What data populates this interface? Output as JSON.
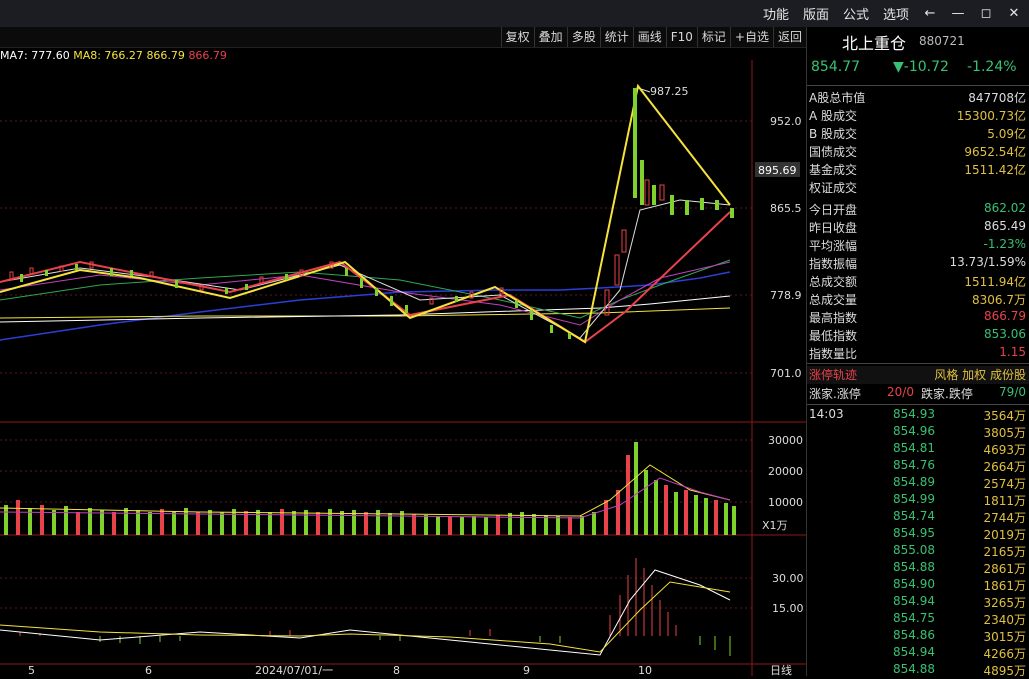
{
  "menu": {
    "items": [
      "功能",
      "版面",
      "公式",
      "选项"
    ],
    "back_icon": "←",
    "min_icon": "—",
    "restore_icon": "◻",
    "close_icon": "✕"
  },
  "toolbar": {
    "buttons": [
      "复权",
      "叠加",
      "多股",
      "统计",
      "画线",
      "F10",
      "标记",
      "+自选",
      "返回"
    ]
  },
  "ma_legend": {
    "ma7": "MA7: 777.60",
    "ma8": "MA8: 766.27",
    "v1": "866.79",
    "v2": "866.79"
  },
  "price_axis": [
    "952.0",
    "865.5",
    "778.9",
    "701.0"
  ],
  "current_price_tag": "895.69",
  "high_label": "987.25",
  "volume_axis": [
    "30000",
    "20000",
    "10000"
  ],
  "volume_unit": "X1万",
  "macd_axis": [
    "30.00",
    "15.00"
  ],
  "date_axis": [
    "5",
    "6",
    "2024/07/01/一",
    "8",
    "9",
    "10",
    "日线"
  ],
  "colors": {
    "up": "#e8424b",
    "down": "#7fd12b",
    "yellow": "#f5e23b",
    "green": "#38c172",
    "blue": "#2b3fd6"
  },
  "chart_data": {
    "type": "candlestick",
    "price_ticks": [
      952.0,
      865.5,
      778.9,
      701.0
    ],
    "volume_ticks": [
      30000,
      20000,
      10000
    ],
    "macd_ticks": [
      30.0,
      15.0
    ],
    "high_marker": 987.25
  },
  "quote": {
    "name": "北上重仓",
    "code": "880721",
    "price": "854.77",
    "change": "▼-10.72",
    "pct": "-1.24%"
  },
  "stats": [
    {
      "k": "A股总市值",
      "v": "847708亿",
      "c": "#ddd"
    },
    {
      "k": "A 股成交",
      "v": "15300.73亿",
      "c": "#e0c040"
    },
    {
      "k": "B 股成交",
      "v": "5.09亿",
      "c": "#e0c040"
    },
    {
      "k": "国债成交",
      "v": "9652.54亿",
      "c": "#e0c040"
    },
    {
      "k": "基金成交",
      "v": "1511.42亿",
      "c": "#e0c040"
    },
    {
      "k": "权证成交",
      "v": "",
      "c": "#e0c040"
    },
    {
      "k": "今日开盘",
      "v": "862.02",
      "c": "#38c172"
    },
    {
      "k": "昨日收盘",
      "v": "865.49",
      "c": "#ddd"
    },
    {
      "k": "平均涨幅",
      "v": "-1.23%",
      "c": "#38c172"
    },
    {
      "k": "指数振幅",
      "v": "13.73/1.59%",
      "c": "#ddd"
    },
    {
      "k": "总成交额",
      "v": "1511.94亿",
      "c": "#e0c040"
    },
    {
      "k": "总成交量",
      "v": "8306.7万",
      "c": "#e0c040"
    },
    {
      "k": "最高指数",
      "v": "866.79",
      "c": "#e8424b"
    },
    {
      "k": "最低指数",
      "v": "853.06",
      "c": "#38c172"
    },
    {
      "k": "指数量比",
      "v": "1.15",
      "c": "#e8424b"
    }
  ],
  "track": {
    "left": "涨停轨迹",
    "right": "风格 加权 成份股"
  },
  "updown": {
    "a": "涨家.涨停",
    "av": "20/0",
    "b": "跌家.跌停",
    "bv": "79/0"
  },
  "ticks": [
    {
      "t": "14:03",
      "p": "854.93",
      "v": "3564万"
    },
    {
      "t": "",
      "p": "854.96",
      "v": "3805万"
    },
    {
      "t": "",
      "p": "854.81",
      "v": "4693万"
    },
    {
      "t": "",
      "p": "854.76",
      "v": "2664万"
    },
    {
      "t": "",
      "p": "854.89",
      "v": "2574万"
    },
    {
      "t": "",
      "p": "854.99",
      "v": "1811万"
    },
    {
      "t": "",
      "p": "854.74",
      "v": "2744万"
    },
    {
      "t": "",
      "p": "854.95",
      "v": "2019万"
    },
    {
      "t": "",
      "p": "855.08",
      "v": "2165万"
    },
    {
      "t": "",
      "p": "854.88",
      "v": "2861万"
    },
    {
      "t": "",
      "p": "854.90",
      "v": "1861万"
    },
    {
      "t": "",
      "p": "854.94",
      "v": "3265万"
    },
    {
      "t": "",
      "p": "854.75",
      "v": "2340万"
    },
    {
      "t": "",
      "p": "854.86",
      "v": "3015万"
    },
    {
      "t": "",
      "p": "854.94",
      "v": "4266万"
    },
    {
      "t": "",
      "p": "854.88",
      "v": "4895万"
    }
  ]
}
